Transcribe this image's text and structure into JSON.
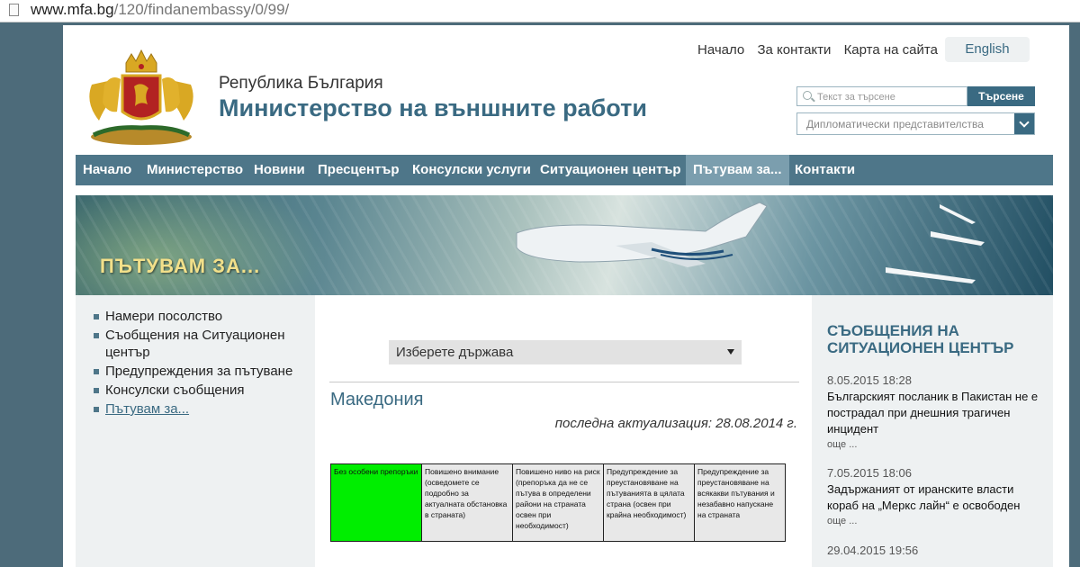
{
  "browser": {
    "url_domain": "www.mfa.bg",
    "url_path": "/120/findanembassy/0/99/"
  },
  "header": {
    "republic": "Република България",
    "ministry": "Министерство на външните работи",
    "top_links": [
      "Начало",
      "За контакти",
      "Карта на сайта"
    ],
    "language_button": "English",
    "search_placeholder": "Текст за търсене",
    "search_button": "Търсене",
    "representations_select": "Дипломатически представителства"
  },
  "nav": {
    "items": [
      "Начало",
      "Министерство",
      "Новини",
      "Пресцентър",
      "Консулски услуги",
      "Ситуационен център",
      "Пътувам за...",
      "Контакти"
    ],
    "active": "Пътувам за..."
  },
  "banner": {
    "title": "ПЪТУВАМ ЗА..."
  },
  "sidebar": {
    "items": [
      "Намери посолство",
      "Съобщения на Ситуационен център",
      "Предупреждения за пътуване",
      "Консулски съобщения",
      "Пътувам за..."
    ]
  },
  "main": {
    "country_select": "Изберете държава",
    "country_name": "Македония",
    "last_updated": "последна актуализация: 28.08.2014 г.",
    "risk_levels": [
      "Без особени препоръки",
      "Повишено внимание (осведомете се подробно за актуалната обстановка в страната)",
      "Повишено ниво на риск (препоръка да не се пътува в определени райони на страната освен при необходимост)",
      "Предупреждение за преустановяване на пътуванията в цялата страна (освен при крайна необходимост)",
      "Предупреждение за преустановяване на всякакви пътувания и незабавно напускане на страната"
    ],
    "active_color": "#00ee00"
  },
  "news": {
    "heading": "СЪОБЩЕНИЯ НА СИТУАЦИОНЕН ЦЕНТЪР",
    "items": [
      {
        "date": "8.05.2015 18:28",
        "text": "Българският посланик в Пакистан не е пострадал при днешния трагичен инцидент",
        "more": "още ..."
      },
      {
        "date": "7.05.2015 18:06",
        "text": "Задържаният от иранските власти кораб на „Меркс лайн“ е освободен",
        "more": "още ..."
      },
      {
        "date": "29.04.2015 19:56",
        "text": ""
      }
    ]
  },
  "colors": {
    "brand": "#3a6a82",
    "nav_bg": "#4e7689",
    "nav_active": "#7b9eae"
  }
}
